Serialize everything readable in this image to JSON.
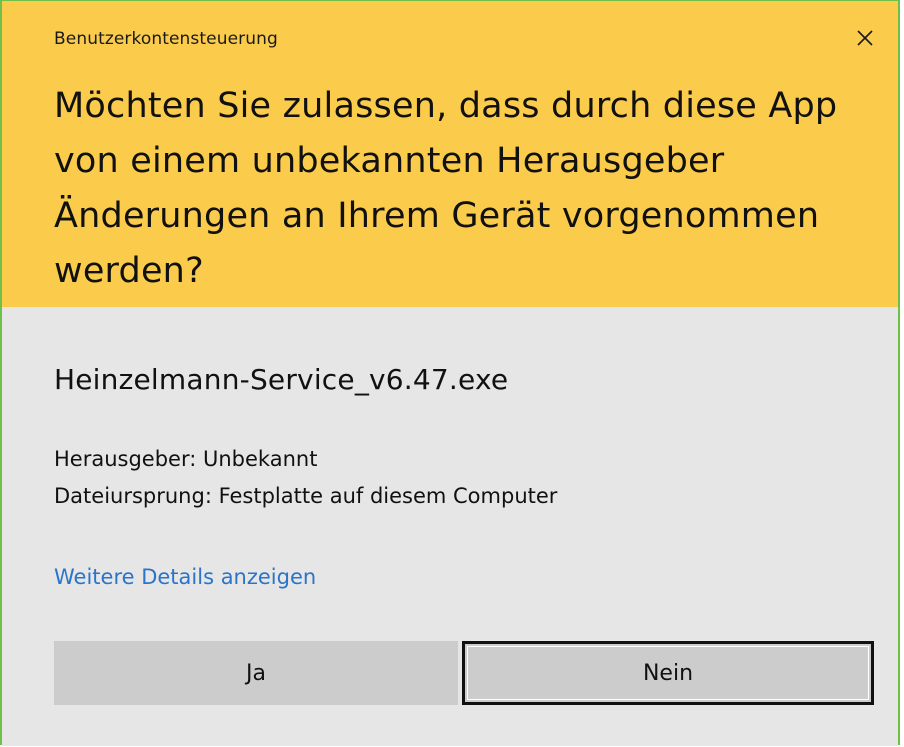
{
  "dialog": {
    "title": "Benutzerkontensteuerung",
    "close_icon": "close-icon",
    "question": "Möchten Sie zulassen, dass durch diese App von einem unbekannten Herausgeber Änderungen an Ihrem Gerät vorgenommen werden?",
    "app_name": "Heinzelmann-Service_v6.47.exe",
    "publisher": "Herausgeber: Unbekannt",
    "origin": "Dateiursprung: Festplatte auf diesem Computer",
    "details_link": "Weitere Details anzeigen",
    "yes_label": "Ja",
    "no_label": "Nein"
  },
  "colors": {
    "header_background": "#fbcb4c",
    "body_background": "#e6e6e6",
    "button_background": "#cccccc",
    "link": "#2a74c9",
    "frame_border": "#6fc04a"
  }
}
